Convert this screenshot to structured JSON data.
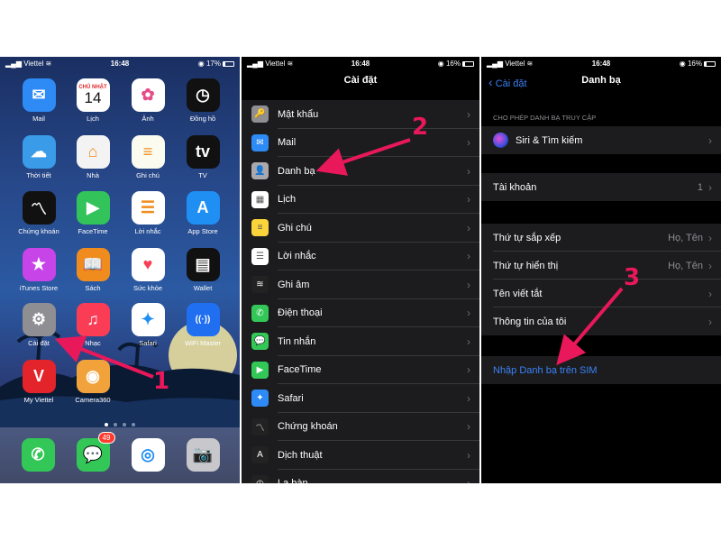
{
  "screen1": {
    "status": {
      "carrier": "Viettel",
      "time": "16:48",
      "battery": "17%",
      "battery_level": 0.17
    },
    "apps": [
      {
        "label": "Mail",
        "icon": "mail-icon",
        "color": "#2e8af5",
        "glyph": "✉"
      },
      {
        "label": "Lịch",
        "icon": "calendar-icon",
        "color": "#ffffff",
        "glyph": "",
        "cal_day": "CHỦ NHẬT",
        "cal_date": "14"
      },
      {
        "label": "Ảnh",
        "icon": "photos-icon",
        "color": "#ffffff",
        "glyph": "✿"
      },
      {
        "label": "Đồng hồ",
        "icon": "clock-icon",
        "color": "#111111",
        "glyph": "◷"
      },
      {
        "label": "Thời tiết",
        "icon": "weather-icon",
        "color": "#3a9be9",
        "glyph": "☁"
      },
      {
        "label": "Nhà",
        "icon": "home-icon",
        "color": "#f3f3f3",
        "glyph": "⌂"
      },
      {
        "label": "Ghi chú",
        "icon": "notes-icon",
        "color": "#fbfbf0",
        "glyph": "≡"
      },
      {
        "label": "TV",
        "icon": "tv-icon",
        "color": "#111111",
        "glyph": "tv"
      },
      {
        "label": "Chứng khoán",
        "icon": "stocks-icon",
        "color": "#111111",
        "glyph": "〽"
      },
      {
        "label": "FaceTime",
        "icon": "facetime-icon",
        "color": "#32c35a",
        "glyph": "▶"
      },
      {
        "label": "Lời nhắc",
        "icon": "reminders-icon",
        "color": "#ffffff",
        "glyph": "☰"
      },
      {
        "label": "App Store",
        "icon": "app-store-icon",
        "color": "#1f8ff3",
        "glyph": "A"
      },
      {
        "label": "iTunes Store",
        "icon": "itunes-store-icon",
        "color": "#c644e8",
        "glyph": "★"
      },
      {
        "label": "Sách",
        "icon": "books-icon",
        "color": "#f08c1e",
        "glyph": "📖"
      },
      {
        "label": "Sức khỏe",
        "icon": "health-icon",
        "color": "#ffffff",
        "glyph": "♥"
      },
      {
        "label": "Wallet",
        "icon": "wallet-icon",
        "color": "#111111",
        "glyph": "▤"
      },
      {
        "label": "Cài đặt",
        "icon": "settings-gear-icon",
        "color": "#8e8e93",
        "glyph": "⚙"
      },
      {
        "label": "Nhạc",
        "icon": "music-icon",
        "color": "#fa3c55",
        "glyph": "♫"
      },
      {
        "label": "Safari",
        "icon": "safari-icon",
        "color": "#ffffff",
        "glyph": "✦"
      },
      {
        "label": "WiFi Master",
        "icon": "wifi-master-icon",
        "color": "#1f6ff0",
        "glyph": "((·))"
      },
      {
        "label": "My Viettel",
        "icon": "my-viettel-icon",
        "color": "#e3242b",
        "glyph": "V"
      },
      {
        "label": "Camera360",
        "icon": "camera360-icon",
        "color": "#f2a23a",
        "glyph": "◉"
      }
    ],
    "dock": [
      {
        "icon": "phone-icon",
        "color": "#33c758",
        "glyph": "✆",
        "badge": ""
      },
      {
        "icon": "messages-icon",
        "color": "#33c758",
        "glyph": "💬",
        "badge": "49"
      },
      {
        "icon": "chrome-icon",
        "color": "#ffffff",
        "glyph": "◎",
        "badge": ""
      },
      {
        "icon": "camera-icon",
        "color": "#c7c7cc",
        "glyph": "📷",
        "badge": ""
      }
    ],
    "step": "1"
  },
  "screen2": {
    "status": {
      "carrier": "Viettel",
      "time": "16:48",
      "battery": "16%",
      "battery_level": 0.16
    },
    "title": "Cài đặt",
    "rows": [
      {
        "label": "Mật khẩu",
        "icon": "key-icon",
        "color": "#8e8e93",
        "glyph": "🔑"
      },
      {
        "label": "Mail",
        "icon": "mail-icon",
        "color": "#2e8af5",
        "glyph": "✉"
      },
      {
        "label": "Danh bạ",
        "icon": "contacts-icon",
        "color": "#a8a8ad",
        "glyph": "👤"
      },
      {
        "label": "Lịch",
        "icon": "calendar-icon",
        "color": "#ffffff",
        "glyph": "▦"
      },
      {
        "label": "Ghi chú",
        "icon": "notes-icon",
        "color": "#fbd43b",
        "glyph": "≡"
      },
      {
        "label": "Lời nhắc",
        "icon": "reminders-icon",
        "color": "#ffffff",
        "glyph": "☰"
      },
      {
        "label": "Ghi âm",
        "icon": "voice-memos-icon",
        "color": "#222222",
        "glyph": "≋"
      },
      {
        "label": "Điện thoại",
        "icon": "phone-icon",
        "color": "#33c758",
        "glyph": "✆"
      },
      {
        "label": "Tin nhắn",
        "icon": "messages-icon",
        "color": "#33c758",
        "glyph": "💬"
      },
      {
        "label": "FaceTime",
        "icon": "facetime-icon",
        "color": "#33c758",
        "glyph": "▶"
      },
      {
        "label": "Safari",
        "icon": "safari-icon",
        "color": "#2e8af5",
        "glyph": "✦"
      },
      {
        "label": "Chứng khoán",
        "icon": "stocks-icon",
        "color": "#222222",
        "glyph": "〽"
      },
      {
        "label": "Dịch thuật",
        "icon": "translate-icon",
        "color": "#222222",
        "glyph": "A"
      },
      {
        "label": "La bàn",
        "icon": "compass-icon",
        "color": "#222222",
        "glyph": "◴"
      }
    ],
    "step": "2"
  },
  "screen3": {
    "status": {
      "carrier": "Viettel",
      "time": "16:48",
      "battery": "16%",
      "battery_level": 0.16
    },
    "back_label": "Cài đặt",
    "title": "Danh bạ",
    "section_header": "CHO PHÉP DANH BẠ TRUY CẬP",
    "siri_row": {
      "label": "Siri & Tìm kiếm",
      "icon": "siri-icon"
    },
    "account_row": {
      "label": "Tài khoản",
      "value": "1"
    },
    "rows": [
      {
        "label": "Thứ tự sắp xếp",
        "value": "Họ, Tên"
      },
      {
        "label": "Thứ tự hiển thị",
        "value": "Họ, Tên"
      },
      {
        "label": "Tên viết tắt",
        "value": ""
      },
      {
        "label": "Thông tin của tôi",
        "value": ""
      }
    ],
    "import_sim": "Nhập Danh bạ trên SIM",
    "step": "3"
  },
  "colors": {
    "accent": "#e8185a",
    "ios_blue": "#3b82f6",
    "cell_bg": "#1c1c1e"
  }
}
